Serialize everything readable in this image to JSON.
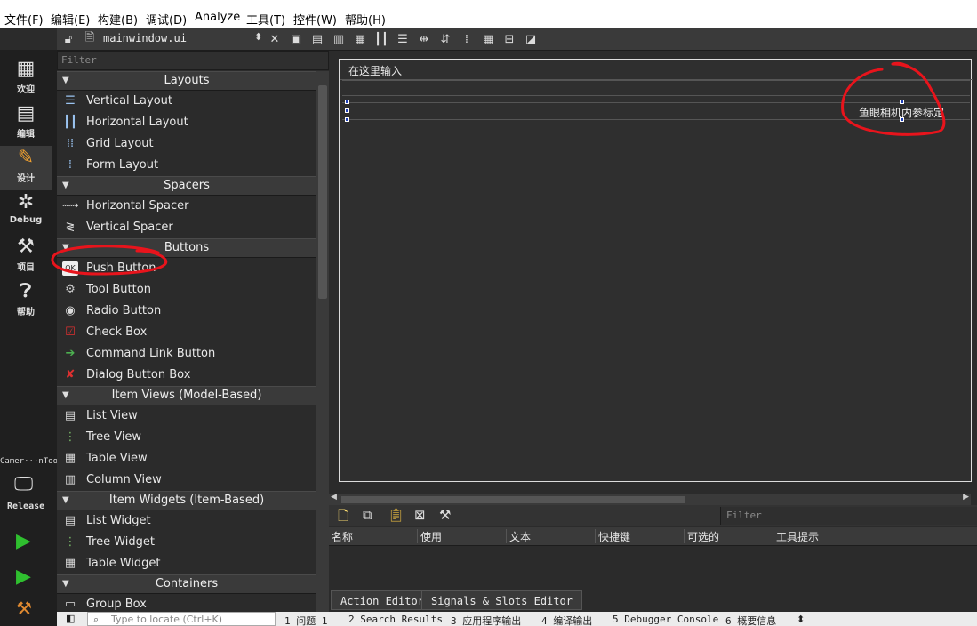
{
  "menu": [
    "文件(F)",
    "编辑(E)",
    "构建(B)",
    "调试(D)",
    "Analyze",
    "工具(T)",
    "控件(W)",
    "帮助(H)"
  ],
  "toolbar": {
    "file_name": "mainwindow.ui"
  },
  "modes": [
    {
      "label": "欢迎",
      "icon": "grid-icon"
    },
    {
      "label": "编辑",
      "icon": "document-icon"
    },
    {
      "label": "设计",
      "icon": "pencil-icon"
    },
    {
      "label": "Debug",
      "icon": "bug-icon"
    },
    {
      "label": "项目",
      "icon": "wrench-icon"
    },
    {
      "label": "帮助",
      "icon": "help-icon"
    }
  ],
  "kit": {
    "project": "Camer···nTool",
    "build": "Release"
  },
  "widgetbox": {
    "filter_placeholder": "Filter",
    "categories": {
      "layouts": "Layouts",
      "spacers": "Spacers",
      "buttons": "Buttons",
      "item_views": "Item Views (Model-Based)",
      "item_widgets": "Item Widgets (Item-Based)",
      "containers": "Containers"
    },
    "items": {
      "vertical_layout": "Vertical Layout",
      "horizontal_layout": "Horizontal Layout",
      "grid_layout": "Grid Layout",
      "form_layout": "Form Layout",
      "horizontal_spacer": "Horizontal Spacer",
      "vertical_spacer": "Vertical Spacer",
      "push_button": "Push Button",
      "tool_button": "Tool Button",
      "radio_button": "Radio Button",
      "check_box": "Check Box",
      "command_link_button": "Command Link Button",
      "dialog_button_box": "Dialog Button Box",
      "list_view": "List View",
      "tree_view": "Tree View",
      "table_view": "Table View",
      "column_view": "Column View",
      "list_widget": "List Widget",
      "tree_widget": "Tree Widget",
      "table_widget": "Table Widget",
      "group_box": "Group Box"
    }
  },
  "form": {
    "input_text": "在这里输入",
    "button_label": "鱼眼相机内参标定"
  },
  "action_editor": {
    "filter_placeholder": "Filter",
    "columns": [
      "名称",
      "使用",
      "文本",
      "快捷键",
      "可选的",
      "工具提示"
    ]
  },
  "editor_tabs": [
    "Action Editor",
    "Signals & Slots Editor"
  ],
  "status": {
    "locate_placeholder": "Type to locate (Ctrl+K)",
    "panes": [
      "1 问题 1",
      "2 Search Results",
      "3 应用程序输出",
      "4 编译输出",
      "5 Debugger Console",
      "6 概要信息"
    ]
  },
  "colors": {
    "annotation": "#e8141c",
    "selection_handle": "#1e3fb8"
  }
}
